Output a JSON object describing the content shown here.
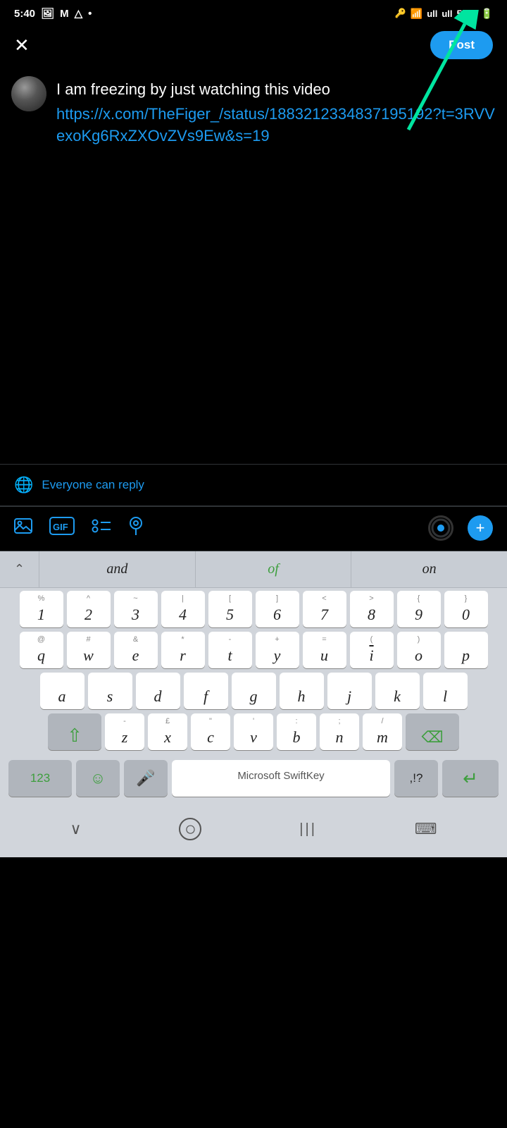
{
  "statusBar": {
    "time": "5:40",
    "icons": [
      "photo",
      "mail",
      "drive",
      "dot"
    ],
    "rightIcons": [
      "key",
      "wifi",
      "signal1",
      "signal2"
    ],
    "battery": "53%"
  },
  "topBar": {
    "closeLabel": "✕",
    "postLabel": "Post"
  },
  "compose": {
    "tweetText": "I am freezing by just watching this video",
    "tweetLink": "https://x.com/TheFiger_/status/18832123348371951​92?t=3RVVexoKg6RxZXOvZVs9Ew&s=19"
  },
  "replySettings": {
    "icon": "🌐",
    "text": "Everyone can reply"
  },
  "toolbar": {
    "imageIcon": "🖼",
    "gifLabel": "GIF",
    "listIcon": "☰",
    "locationIcon": "📍",
    "addLabel": "+"
  },
  "suggestions": {
    "chevron": "⌃",
    "words": [
      "and",
      "of",
      "on"
    ]
  },
  "keyboard": {
    "row1": [
      {
        "main": "1",
        "sub": ""
      },
      {
        "main": "2",
        "sub": ""
      },
      {
        "main": "3",
        "sub": ""
      },
      {
        "main": "4",
        "sub": ""
      },
      {
        "main": "5",
        "sub": ""
      },
      {
        "main": "6",
        "sub": ""
      },
      {
        "main": "7",
        "sub": ""
      },
      {
        "main": "8",
        "sub": ""
      },
      {
        "main": "9",
        "sub": ""
      },
      {
        "main": "0",
        "sub": ""
      }
    ],
    "row1subs": [
      "%",
      "^",
      "~",
      "|",
      "[",
      "]",
      "<",
      ">",
      "{",
      "}"
    ],
    "row2": [
      "q",
      "w",
      "e",
      "r",
      "t",
      "y",
      "u",
      "i",
      "o",
      "p"
    ],
    "row2subs": [
      "@",
      "#",
      "&",
      "*",
      "-",
      "+",
      "=",
      "(",
      ")",
      ")"
    ],
    "row3": [
      "a",
      "s",
      "d",
      "f",
      "g",
      "h",
      "j",
      "k",
      "l"
    ],
    "row3subs": [
      "",
      "",
      "",
      "",
      "",
      "",
      "",
      "",
      ""
    ],
    "row4": [
      "z",
      "x",
      "c",
      "v",
      "b",
      "n",
      "m"
    ],
    "row4subs": [
      "-",
      "£",
      "\"",
      "'",
      ":",
      ";",
      " /"
    ],
    "spaceLabel": "Microsoft SwiftKey",
    "numberLabel": "123",
    "emojiLabel": "☺",
    "micLabel": "🎤",
    "punctLabel": ",!?",
    "commaLabel": ",",
    "periodLabel": ".",
    "returnLabel": "↵",
    "backspaceLabel": "⌫",
    "shiftLabel": "⇧"
  },
  "navBar": {
    "downLabel": "∨",
    "homeLabel": "○",
    "menuLabel": "|||",
    "keyboardLabel": "⌨"
  }
}
